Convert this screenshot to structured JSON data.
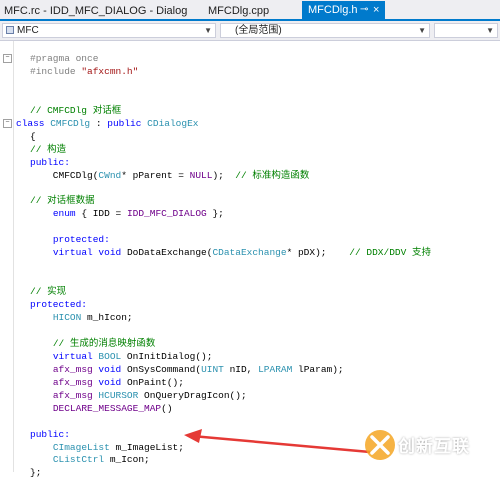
{
  "tabs": [
    {
      "label": "MFC.rc - IDD_MFC_DIALOG - Dialog",
      "active": false
    },
    {
      "label": "MFCDlg.cpp",
      "active": false
    },
    {
      "label": "MFCDlg.h",
      "active": true,
      "pin_icon": "pin-icon",
      "close_icon": "close-icon"
    }
  ],
  "nav": {
    "project": "MFC",
    "scope": "(全局范围)",
    "member": ""
  },
  "code_lines": [
    {
      "segs": [
        {
          "t": "#pragma once",
          "c": "pp"
        }
      ]
    },
    {
      "segs": [
        {
          "t": "#include ",
          "c": "pp"
        },
        {
          "t": "\"afxcmn.h\"",
          "c": "st"
        }
      ]
    },
    {
      "segs": []
    },
    {
      "segs": []
    },
    {
      "segs": [
        {
          "t": "// CMFCDlg 对话框",
          "c": "cm"
        }
      ]
    },
    {
      "segs": [
        {
          "t": "class ",
          "c": "kw"
        },
        {
          "t": "CMFCDlg",
          "c": "ty"
        },
        {
          "t": " : ",
          "c": ""
        },
        {
          "t": "public ",
          "c": "kw"
        },
        {
          "t": "CDialogEx",
          "c": "ty"
        }
      ]
    },
    {
      "segs": [
        {
          "t": "{",
          "c": ""
        }
      ]
    },
    {
      "segs": [
        {
          "t": "// 构造",
          "c": "cm"
        }
      ]
    },
    {
      "segs": [
        {
          "t": "public:",
          "c": "kw"
        }
      ]
    },
    {
      "segs": [
        {
          "t": "    CMFCDlg(",
          "c": ""
        },
        {
          "t": "CWnd",
          "c": "ty"
        },
        {
          "t": "* pParent = ",
          "c": ""
        },
        {
          "t": "NULL",
          "c": "mc"
        },
        {
          "t": ");  ",
          "c": ""
        },
        {
          "t": "// 标准构造函数",
          "c": "cm"
        }
      ]
    },
    {
      "segs": []
    },
    {
      "segs": [
        {
          "t": "// 对话框数据",
          "c": "cm"
        }
      ]
    },
    {
      "segs": [
        {
          "t": "    ",
          "c": ""
        },
        {
          "t": "enum",
          "c": "kw"
        },
        {
          "t": " { IDD = ",
          "c": ""
        },
        {
          "t": "IDD_MFC_DIALOG",
          "c": "mc"
        },
        {
          "t": " };",
          "c": ""
        }
      ]
    },
    {
      "segs": []
    },
    {
      "segs": [
        {
          "t": "    ",
          "c": ""
        },
        {
          "t": "protected:",
          "c": "kw"
        }
      ]
    },
    {
      "segs": [
        {
          "t": "    ",
          "c": ""
        },
        {
          "t": "virtual void ",
          "c": "kw"
        },
        {
          "t": "DoDataExchange(",
          "c": ""
        },
        {
          "t": "CDataExchange",
          "c": "ty"
        },
        {
          "t": "* pDX);    ",
          "c": ""
        },
        {
          "t": "// DDX/DDV 支持",
          "c": "cm"
        }
      ]
    },
    {
      "segs": []
    },
    {
      "segs": []
    },
    {
      "segs": [
        {
          "t": "// 实现",
          "c": "cm"
        }
      ]
    },
    {
      "segs": [
        {
          "t": "protected:",
          "c": "kw"
        }
      ]
    },
    {
      "segs": [
        {
          "t": "    ",
          "c": ""
        },
        {
          "t": "HICON",
          "c": "ty"
        },
        {
          "t": " m_hIcon;",
          "c": ""
        }
      ]
    },
    {
      "segs": []
    },
    {
      "segs": [
        {
          "t": "    ",
          "c": ""
        },
        {
          "t": "// 生成的消息映射函数",
          "c": "cm"
        }
      ]
    },
    {
      "segs": [
        {
          "t": "    ",
          "c": ""
        },
        {
          "t": "virtual ",
          "c": "kw"
        },
        {
          "t": "BOOL",
          "c": "ty"
        },
        {
          "t": " OnInitDialog();",
          "c": ""
        }
      ]
    },
    {
      "segs": [
        {
          "t": "    ",
          "c": ""
        },
        {
          "t": "afx_msg ",
          "c": "mc"
        },
        {
          "t": "void ",
          "c": "kw"
        },
        {
          "t": "OnSysCommand(",
          "c": ""
        },
        {
          "t": "UINT",
          "c": "ty"
        },
        {
          "t": " nID, ",
          "c": ""
        },
        {
          "t": "LPARAM",
          "c": "ty"
        },
        {
          "t": " lParam);",
          "c": ""
        }
      ]
    },
    {
      "segs": [
        {
          "t": "    ",
          "c": ""
        },
        {
          "t": "afx_msg ",
          "c": "mc"
        },
        {
          "t": "void ",
          "c": "kw"
        },
        {
          "t": "OnPaint();",
          "c": ""
        }
      ]
    },
    {
      "segs": [
        {
          "t": "    ",
          "c": ""
        },
        {
          "t": "afx_msg ",
          "c": "mc"
        },
        {
          "t": "HCURSOR",
          "c": "ty"
        },
        {
          "t": " OnQueryDragIcon();",
          "c": ""
        }
      ]
    },
    {
      "segs": [
        {
          "t": "    ",
          "c": ""
        },
        {
          "t": "DECLARE_MESSAGE_MAP",
          "c": "mc"
        },
        {
          "t": "()",
          "c": ""
        }
      ]
    },
    {
      "segs": []
    },
    {
      "segs": [
        {
          "t": "public:",
          "c": "kw"
        }
      ]
    },
    {
      "segs": [
        {
          "t": "    ",
          "c": ""
        },
        {
          "t": "CImageList",
          "c": "ty"
        },
        {
          "t": " m_ImageList;",
          "c": ""
        }
      ]
    },
    {
      "segs": [
        {
          "t": "    ",
          "c": ""
        },
        {
          "t": "CListCtrl",
          "c": "ty"
        },
        {
          "t": " m_Icon;",
          "c": ""
        }
      ]
    },
    {
      "segs": [
        {
          "t": "};",
          "c": ""
        }
      ]
    }
  ],
  "folds": [
    {
      "line": 0,
      "symbol": "−"
    },
    {
      "line": 5,
      "symbol": "−"
    }
  ],
  "annotation": {
    "type": "red-arrow",
    "color": "#e53935"
  },
  "watermark": {
    "text": "创新互联",
    "logo": "x-logo-icon"
  },
  "colors": {
    "accent": "#007acc",
    "keyword": "#0000ff",
    "type": "#2b91af",
    "comment": "#008000",
    "string": "#a31515",
    "macro": "#6f008a"
  }
}
